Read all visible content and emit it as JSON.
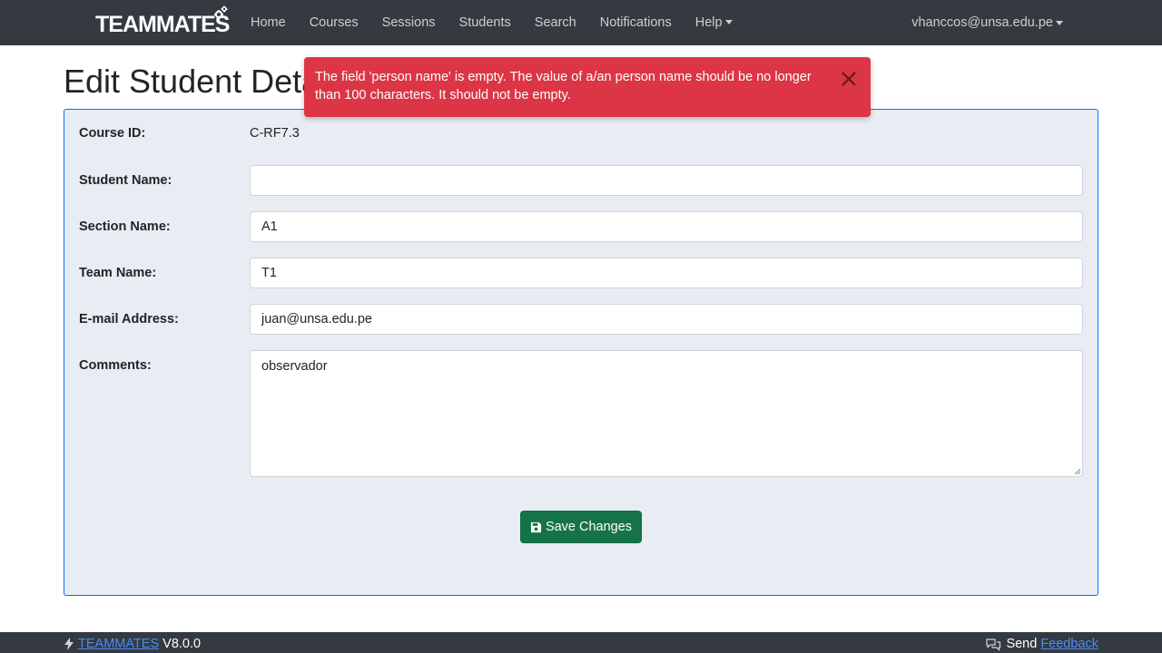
{
  "navbar": {
    "brand": "TEAMMATES",
    "links": {
      "home": "Home",
      "courses": "Courses",
      "sessions": "Sessions",
      "students": "Students",
      "search": "Search",
      "notifications": "Notifications",
      "help": "Help"
    },
    "user": "vhanccos@unsa.edu.pe"
  },
  "page": {
    "title": "Edit Student Details"
  },
  "alert": {
    "message": "The field 'person name' is empty. The value of a/an person name should be no longer than 100 characters. It should not be empty.",
    "color": "#dc3545"
  },
  "form": {
    "course_id_label": "Course ID:",
    "course_id_value": "C-RF7.3",
    "student_name_label": "Student Name:",
    "student_name_value": "",
    "section_name_label": "Section Name:",
    "section_name_value": "A1",
    "team_name_label": "Team Name:",
    "team_name_value": "T1",
    "email_label": "E-mail Address:",
    "email_value": "juan@unsa.edu.pe",
    "comments_label": "Comments:",
    "comments_value": "observador",
    "save_label": "Save Changes"
  },
  "footer": {
    "brand_link": "TEAMMATES",
    "version": "V8.0.0",
    "send_text": "Send",
    "feedback_link": "Feedback"
  },
  "icons": {
    "gear": "gear-icon",
    "close": "close-icon",
    "save": "floppy-disk-icon",
    "bolt": "bolt-icon",
    "chat": "chat-icon",
    "caret": "caret-down-icon"
  },
  "colors": {
    "navbar_bg": "#343a40",
    "card_bg": "#e8edf3",
    "card_border": "#0d6efd",
    "save_button": "#157347",
    "link": "#4a8cf7"
  }
}
